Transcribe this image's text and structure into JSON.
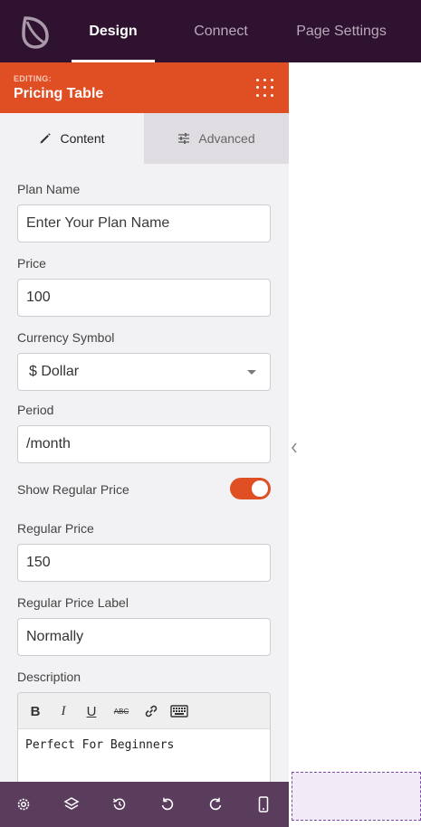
{
  "nav": {
    "tabs": [
      {
        "label": "Design",
        "active": true
      },
      {
        "label": "Connect",
        "active": false
      },
      {
        "label": "Page Settings",
        "active": false
      }
    ]
  },
  "panel": {
    "editing_label": "EDITING:",
    "title": "Pricing Table",
    "subtabs": {
      "content": "Content",
      "advanced": "Advanced"
    },
    "fields": {
      "plan_name": {
        "label": "Plan Name",
        "placeholder": "Enter Your Plan Name",
        "value": ""
      },
      "price": {
        "label": "Price",
        "value": "100"
      },
      "currency": {
        "label": "Currency Symbol",
        "selected": "$ Dollar"
      },
      "period": {
        "label": "Period",
        "value": "/month"
      },
      "show_regular_price": {
        "label": "Show Regular Price",
        "on": true
      },
      "regular_price": {
        "label": "Regular Price",
        "value": "150"
      },
      "regular_price_label": {
        "label": "Regular Price Label",
        "value": "Normally"
      },
      "description": {
        "label": "Description",
        "value": "Perfect For Beginners"
      }
    },
    "editor_toolbar": {
      "bold": "B",
      "italic": "I",
      "underline": "U",
      "strike": "ABC"
    }
  },
  "colors": {
    "topbar": "#2f1130",
    "accent": "#e04e23",
    "bottombar": "#5a3c5d"
  }
}
